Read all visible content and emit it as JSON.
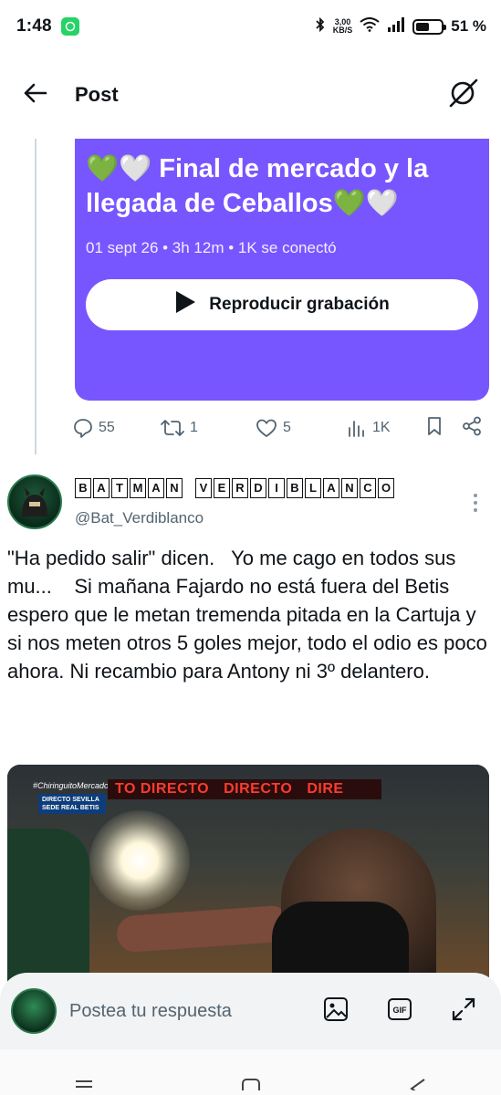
{
  "status_bar": {
    "time": "1:48",
    "net_speed_value": "3,00",
    "net_speed_unit": "KB/S",
    "battery_text": "51 %",
    "battery_level": 0.51
  },
  "header": {
    "title": "Post"
  },
  "space": {
    "title": "💚🤍 Final de mercado y la llegada de Ceballos💚🤍",
    "meta": "01 sept 26 • 3h 12m • 1K se conectó",
    "play_label": "Reproducir grabación",
    "bg_color": "#7856ff"
  },
  "actions": {
    "replies": "55",
    "reposts": "1",
    "likes": "5",
    "views": "1K"
  },
  "tweet": {
    "display_name_letters": [
      "B",
      "A",
      "T",
      "M",
      "A",
      "N",
      " ",
      "V",
      "E",
      "R",
      "D",
      "I",
      "B",
      "L",
      "A",
      "N",
      "C",
      "O"
    ],
    "handle": "@Bat_Verdiblanco",
    "text": "\"Ha pedido salir\" dicen.   Yo me cago en todos sus mu...    Si mañana Fajardo no está fuera del Betis espero que le metan tremenda pitada en la Cartuja y si nos meten otros 5 goles mejor, todo el odio es poco ahora. Ni recambio para Antony ni 3º delantero.",
    "media": {
      "banner_text": [
        "TO DIRECTO",
        "DIRECTO",
        "DIRE"
      ],
      "hashtag": "#ChiringuitoMercado",
      "location_tag": "DIRECTO SEVILLA SEDE REAL BETIS"
    }
  },
  "reply_bar": {
    "placeholder": "Postea tu respuesta"
  }
}
